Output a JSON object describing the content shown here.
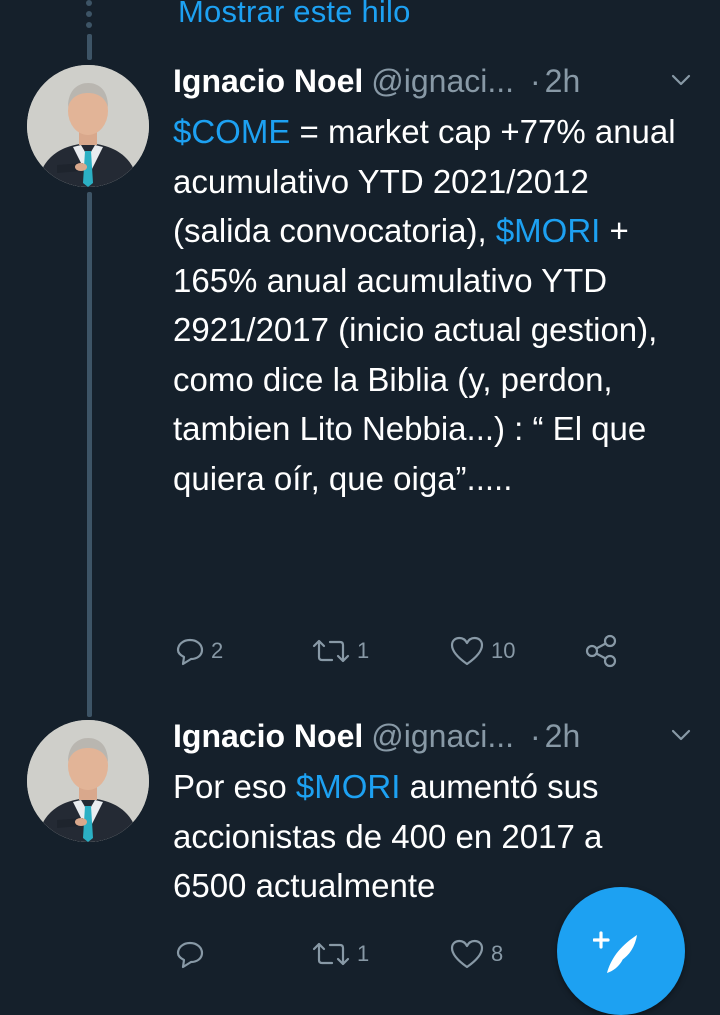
{
  "thread": {
    "show_thread_label": "Mostrar este hilo"
  },
  "tweets": [
    {
      "author_name": "Ignacio Noel",
      "author_handle": "@ignaci...",
      "separator": "·",
      "time": "2h",
      "text_parts": [
        {
          "text": "$COME",
          "cashtag": true
        },
        {
          "text": " = market cap +77% anual acumulativo YTD 2021/2012 (salida convocatoria), ",
          "cashtag": false
        },
        {
          "text": "$MORI",
          "cashtag": true
        },
        {
          "text": " + 165% anual acumulativo YTD 2921/2017 (inicio actual gestion), como dice la Biblia (y, perdon, tambien Lito Nebbia...) : “ El que quiera oír, que oiga”.....",
          "cashtag": false
        }
      ],
      "replies": "2",
      "retweets": "1",
      "likes": "10"
    },
    {
      "author_name": "Ignacio Noel",
      "author_handle": "@ignaci...",
      "separator": "·",
      "time": "2h",
      "text_parts": [
        {
          "text": "Por eso ",
          "cashtag": false
        },
        {
          "text": "$MORI",
          "cashtag": true
        },
        {
          "text": " aumentó sus accionistas de 400 en 2017 a 6500 actualmente",
          "cashtag": false
        }
      ],
      "replies": "",
      "retweets": "1",
      "likes": "8"
    }
  ],
  "icons": {
    "reply": "reply-icon",
    "retweet": "retweet-icon",
    "like": "heart-icon",
    "share": "share-icon",
    "more": "chevron-down-icon",
    "compose": "compose-tweet-icon"
  },
  "colors": {
    "background": "#15202b",
    "accent": "#1da1f2",
    "muted": "#8899a6",
    "thread_line": "#3d5466"
  }
}
